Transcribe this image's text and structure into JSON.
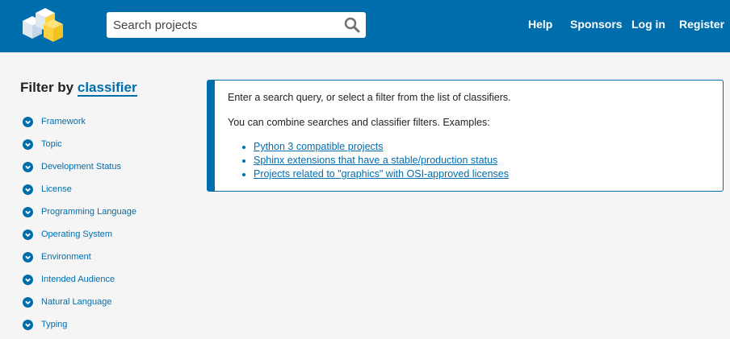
{
  "header": {
    "search": {
      "placeholder": "Search projects",
      "value": ""
    },
    "nav": [
      "Help",
      "Sponsors",
      "Log in",
      "Register"
    ]
  },
  "sidebar": {
    "title_prefix": "Filter by",
    "title_link": "classifier",
    "classifiers": [
      "Framework",
      "Topic",
      "Development Status",
      "License",
      "Programming Language",
      "Operating System",
      "Environment",
      "Intended Audience",
      "Natural Language",
      "Typing"
    ]
  },
  "main": {
    "intro": "Enter a search query, or select a filter from the list of classifiers.",
    "combine": "You can combine searches and classifier filters. Examples:",
    "examples": [
      "Python 3 compatible projects",
      "Sphinx extensions that have a stable/production status",
      "Projects related to \"graphics\" with OSI-approved licenses"
    ]
  },
  "colors": {
    "brand": "#006dad",
    "logo_yellow": "#ffd242",
    "background": "#f5f5f5"
  },
  "icons": {
    "search": "magnifier-icon",
    "classifier": "chevron-down-circle-icon"
  }
}
